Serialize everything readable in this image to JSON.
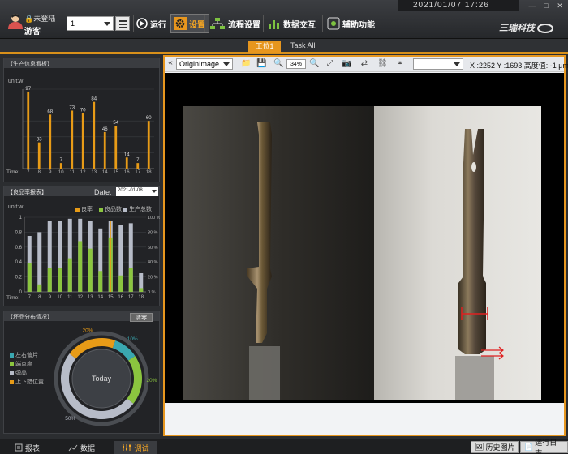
{
  "header": {
    "datetime": "2021/01/07   17:26",
    "user_status": "未登陆",
    "user_name": "游客",
    "station_value": "1",
    "run_label": "运行",
    "settings_label": "设置",
    "flow_label": "流程设置",
    "data_label": "数据交互",
    "aux_label": "辅助功能",
    "logo_text": "三瑞科技"
  },
  "tabs": {
    "active": "工位1",
    "other": "Task All"
  },
  "production_panel": {
    "title": "【生产信息看板】",
    "unit": "unit:w",
    "time_label": "Time:",
    "chart_data": {
      "type": "bar",
      "categories": [
        "7",
        "8",
        "9",
        "10",
        "11",
        "12",
        "13",
        "14",
        "15",
        "16",
        "17",
        "18"
      ],
      "values": [
        97,
        33,
        68,
        7,
        73,
        70,
        84,
        46,
        54,
        14,
        7,
        60
      ],
      "ylim": [
        0,
        100
      ],
      "color": "#e79b17"
    }
  },
  "yield_panel": {
    "title": "【良品率报表】",
    "date_label": "Date:",
    "date_value": "2021-01-08",
    "unit": "unit:w",
    "time_label": "Time:",
    "legend": [
      "良率",
      "良品数",
      "生产总数"
    ],
    "chart_data": {
      "type": "bar",
      "categories": [
        "7",
        "8",
        "9",
        "10",
        "11",
        "12",
        "13",
        "14",
        "15",
        "16",
        "17",
        "18"
      ],
      "left_ticks": [
        "0",
        "0.2",
        "0.4",
        "0.6",
        "0.8",
        "1"
      ],
      "right_ticks": [
        "0 %",
        "20 %",
        "40 %",
        "60 %",
        "80 %",
        "100 %"
      ],
      "series": [
        {
          "name": "生产总数",
          "values": [
            0.75,
            0.8,
            0.95,
            0.95,
            0.98,
            0.98,
            0.95,
            0.85,
            0.95,
            0.9,
            0.92,
            0.25
          ]
        },
        {
          "name": "良品数",
          "values": [
            0.38,
            0.1,
            0.32,
            0.32,
            0.45,
            0.68,
            0.58,
            0.28,
            0.73,
            0.22,
            0.32,
            0.05
          ]
        },
        {
          "name": "良率",
          "values": [
            0.0,
            0.0,
            0.0,
            0.0,
            0.0,
            0.0,
            0.0,
            0.0,
            0.95,
            0.0,
            0.0,
            0.0
          ]
        }
      ],
      "colors": {
        "total": "#b7bcc8",
        "good": "#8bc53f",
        "rate": "#e79b17"
      }
    }
  },
  "defect_panel": {
    "title": "【坏品分布情况】",
    "clear_label": "清零",
    "legend": [
      "左右偏片",
      "端点度",
      "弹高",
      "上下錯位置"
    ],
    "center_text": "Today",
    "chart_data": {
      "type": "pie",
      "labels": [
        "左右偏片",
        "端点度",
        "弹高",
        "上下錯位置"
      ],
      "values": [
        10,
        20,
        50,
        20
      ],
      "display_labels": [
        "10%",
        "20%",
        "50%",
        "20%"
      ],
      "colors": [
        "#3aa7b0",
        "#8bc53f",
        "#b7bcc8",
        "#e79b17"
      ]
    }
  },
  "viewer": {
    "image_source": "OriginImage",
    "zoom": "34%",
    "coords": "X :2252 Y :1693 高度值: -1 μm"
  },
  "footer": {
    "report_label": "报表",
    "data_label": "数据",
    "debug_label": "调试",
    "history_label": "历史图片",
    "log_label": "运行日志"
  }
}
